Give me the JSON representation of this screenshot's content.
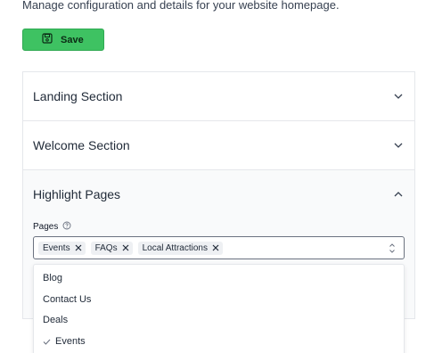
{
  "header": {
    "subtitle": "Manage configuration and details for your website homepage."
  },
  "toolbar": {
    "save_label": "Save"
  },
  "sections": [
    {
      "title": "Landing Section",
      "expanded": false
    },
    {
      "title": "Welcome Section",
      "expanded": false
    },
    {
      "title": "Highlight Pages",
      "expanded": true
    }
  ],
  "highlight": {
    "field_label": "Pages",
    "selected_chips": [
      "Events",
      "FAQs",
      "Local Attractions"
    ]
  },
  "dropdown": {
    "options": [
      {
        "label": "Blog",
        "checked": false
      },
      {
        "label": "Contact Us",
        "checked": false
      },
      {
        "label": "Deals",
        "checked": false
      },
      {
        "label": "Events",
        "checked": true
      }
    ]
  },
  "colors": {
    "save_button": "#3ec262",
    "border": "#e5e7eb",
    "open_section_bg": "#f9fafb"
  },
  "icons": {
    "save": "floppy-disk-icon",
    "collapsed": "chevron-down-icon",
    "expanded": "chevron-up-icon",
    "info": "help-circle-icon",
    "remove_chip": "x-icon",
    "select_toggle": "chevron-up-down-icon",
    "selected_option": "check-icon"
  }
}
